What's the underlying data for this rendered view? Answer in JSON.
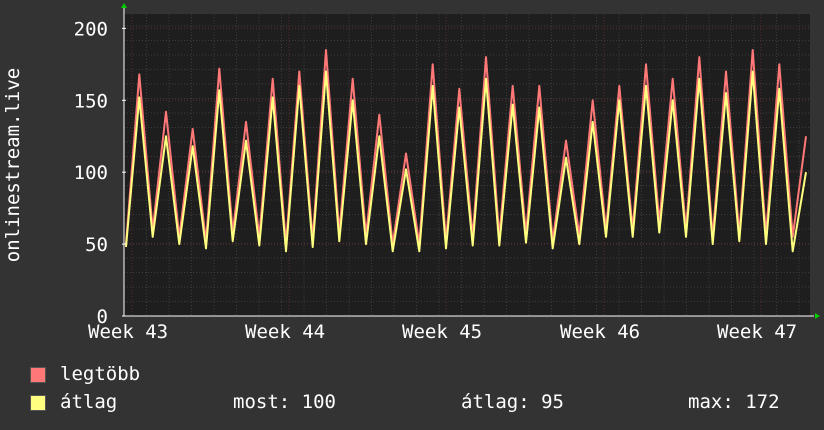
{
  "chart_data": {
    "type": "line",
    "ylabel": "onlinestream.live",
    "ylim": [
      0,
      210
    ],
    "yticks": [
      0,
      50,
      100,
      150,
      200
    ],
    "xticks": [
      "Week 43",
      "Week 44",
      "Week 45",
      "Week 46",
      "Week 47"
    ],
    "grid": true,
    "legend_position": "bottom",
    "colors": {
      "background": "#333333",
      "plot_background": "#1e1e1e",
      "grid_minor": "#3c3c3c",
      "grid_major": "#5a2a2a",
      "axis": "#ffffff",
      "arrow": "#00cc00",
      "series_max": "#ff7878",
      "series_avg": "#ffff80"
    },
    "series": [
      {
        "name": "legtöbb",
        "color": "#ff7878",
        "values": [
          50,
          168,
          60,
          142,
          55,
          130,
          52,
          172,
          58,
          135,
          55,
          165,
          50,
          170,
          53,
          185,
          58,
          165,
          56,
          140,
          50,
          113,
          50,
          175,
          52,
          158,
          55,
          180,
          55,
          160,
          57,
          160,
          52,
          122,
          56,
          150,
          60,
          160,
          60,
          175,
          65,
          165,
          60,
          180,
          55,
          170,
          57,
          185,
          56,
          175,
          55,
          125
        ]
      },
      {
        "name": "átlag",
        "color": "#ffff80",
        "values": [
          48,
          152,
          55,
          125,
          50,
          118,
          47,
          157,
          52,
          122,
          49,
          152,
          45,
          160,
          48,
          170,
          52,
          150,
          50,
          125,
          45,
          102,
          45,
          160,
          47,
          145,
          49,
          165,
          49,
          147,
          51,
          145,
          47,
          110,
          50,
          135,
          55,
          150,
          55,
          160,
          58,
          150,
          55,
          165,
          50,
          155,
          52,
          170,
          50,
          158,
          45,
          100
        ]
      }
    ],
    "stats": {
      "most_label": "most:",
      "most_value": "100",
      "atlag_label": "átlag:",
      "atlag_value": "95",
      "max_label": "max:",
      "max_value": "172"
    }
  }
}
